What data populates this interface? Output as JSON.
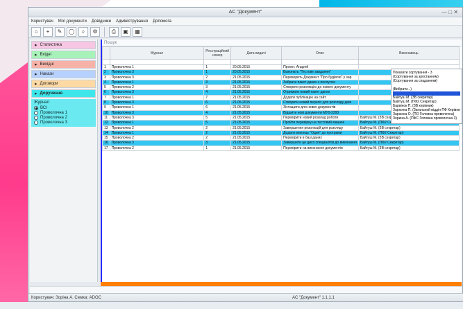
{
  "window": {
    "title": "AC \"Документ\""
  },
  "menu": [
    "Користувач",
    "Мої документи",
    "Довідники",
    "Адміністрування",
    "Допомога"
  ],
  "toolbar": [
    "home-icon",
    "add-icon",
    "edit-icon",
    "refresh-icon",
    "search-icon",
    "settings-icon",
    "print-icon",
    "save-icon",
    "grid-icon"
  ],
  "left": {
    "categories": [
      {
        "label": "Статистика",
        "cls": "stat"
      },
      {
        "label": "Вхідні",
        "cls": "vhid"
      },
      {
        "label": "Вихідні",
        "cls": "vyh"
      },
      {
        "label": "Накази",
        "cls": "nak"
      },
      {
        "label": "Договори",
        "cls": "dog"
      },
      {
        "label": "Доручення",
        "cls": "doruch"
      }
    ],
    "sub": {
      "title": "Журнал",
      "options": [
        {
          "label": "ВСІ",
          "on": true
        },
        {
          "label": "Проволочна 1",
          "on": false
        },
        {
          "label": "Проволочна 2",
          "on": false
        },
        {
          "label": "Проволочна 3",
          "on": false
        }
      ]
    }
  },
  "grid": {
    "search_placeholder": "Пошук",
    "headers": {
      "journal": "Журнал",
      "reg": "Реєстраційний номер",
      "date": "Дата видачі",
      "desc": "Опис",
      "exec": "Виконавець"
    },
    "rows": [
      {
        "n": "1",
        "j": "Проволочна 1",
        "r": "1",
        "d": "20.05.2015",
        "desc": "Проект. Андрей",
        "exec": "",
        "cls": "nor"
      },
      {
        "n": "2",
        "j": "Проволочна 3",
        "r": "1",
        "d": "20.05.2015",
        "desc": "Выконать \"Тестове завдання\"",
        "exec": "",
        "cls": "hl"
      },
      {
        "n": "3",
        "j": "Проволочна 3",
        "r": "2",
        "d": "21.05.2015",
        "desc": "Переверить Документ \"Про будівлю\" у зар",
        "exec": "",
        "cls": "nor"
      },
      {
        "n": "4",
        "j": "Проволочна 1",
        "r": "3",
        "d": "21.05.2015",
        "desc": "Забрати пакет даних з послугою",
        "exec": "",
        "cls": "hl"
      },
      {
        "n": "5",
        "j": "Проволочна 2",
        "r": "3",
        "d": "21.05.2015",
        "desc": "Створити резолюцію до нового документу",
        "exec": "",
        "cls": "nor"
      },
      {
        "n": "6",
        "j": "Проволочна 3",
        "r": "4",
        "d": "21.05.2015",
        "desc": "Отримати новий пакет даних",
        "exec": "",
        "cls": "hl"
      },
      {
        "n": "7",
        "j": "Проволочна 1",
        "r": "7",
        "d": "21.05.2015",
        "desc": "Додати публікацію на сайт",
        "exec": "",
        "cls": "nor"
      },
      {
        "n": "8",
        "j": "Проволочна 3",
        "r": "6",
        "d": "21.05.2015",
        "desc": "Створити новий переліг для розгляду днів",
        "exec": "",
        "cls": "hl"
      },
      {
        "n": "9",
        "j": "Проволочна 1",
        "r": "6",
        "d": "21.05.2015",
        "desc": "Зістащити для нових документів",
        "exec": "",
        "cls": "nor"
      },
      {
        "n": "10",
        "j": "Проволочна 3",
        "r": "4",
        "d": "21.05.2015",
        "desc": "Відшити нові документи МУ0-2293",
        "exec": "",
        "cls": "hl"
      },
      {
        "n": "11",
        "j": "Проволочна 3",
        "r": "5",
        "d": "21.05.2015",
        "desc": "Перевірити новий розклад роботи",
        "exec": "Байтуш М. (ЗВ секретар)",
        "cls": "nor"
      },
      {
        "n": "12",
        "j": "Проволочна 1",
        "r": "5",
        "d": "21.05.2015",
        "desc": "Пройти перевірку на тестовий машині",
        "exec": "Байтуш М. (ПФ2 Секретар)",
        "cls": "hl"
      },
      {
        "n": "13",
        "j": "Проволочна 2",
        "r": "2",
        "d": "21.05.2015",
        "desc": "Завершення резолюцій для розгляду",
        "exec": "Байтуш М. (ЗВ секретар)",
        "cls": "nor"
      },
      {
        "n": "14",
        "j": "Проволочна 1",
        "r": "2",
        "d": "21.05.2015",
        "desc": "Додати виконць \"Один\" до програми",
        "exec": "Байтуш М. (ПФ2 Секретар)",
        "cls": "hl"
      },
      {
        "n": "15",
        "j": "Проволочна 2",
        "r": "2",
        "d": "21.05.2015",
        "desc": "Перевірити в базі даних",
        "exec": "Байтуш М. (ЗВ секретар)",
        "cls": "nor"
      },
      {
        "n": "16",
        "j": "Проволочна 3",
        "r": "3",
        "d": "21.05.2015",
        "desc": "Завершити це дисп.специалітів до виконання",
        "exec": "Байтуш М. (ПФ2 Секретар)",
        "cls": "hl"
      },
      {
        "n": "17",
        "j": "Проволочна 2",
        "r": "1",
        "d": "21.05.2015",
        "desc": "Перевірити на виконання документів",
        "exec": "Байтуш М. (ЗВ секретар)",
        "cls": "nor"
      }
    ],
    "popup": [
      {
        "t": "Показати сортування - 3",
        "hl": false
      },
      {
        "t": "(Сортування за зростанням)",
        "hl": false
      },
      {
        "t": "(Сортування за спаданням)",
        "hl": false
      },
      {
        "t": "",
        "hl": false
      },
      {
        "t": "(Вибрати...)",
        "hl": false
      },
      {
        "t": "",
        "hl": true
      },
      {
        "t": "Байтуш М. (ЗВ секретар)",
        "hl": false
      },
      {
        "t": "Байтуш М. (ПФ2 Секретар)",
        "hl": false
      },
      {
        "t": "Барвінок П. (ЗВ керівник)",
        "hl": false
      },
      {
        "t": "Зарюхна П. (Загальний відділ ПФ Керівник)",
        "hl": false
      },
      {
        "t": "Зарюхна О. (ПО Головна проволочна)",
        "hl": false
      },
      {
        "t": "Зорина А. (ПФС Головна проволочна 3)",
        "hl": false
      }
    ]
  },
  "status": {
    "user": "Користувач: Зоріна А. Семка: АDОС",
    "app": "AC \"Документ\" 1.1.1.1"
  }
}
